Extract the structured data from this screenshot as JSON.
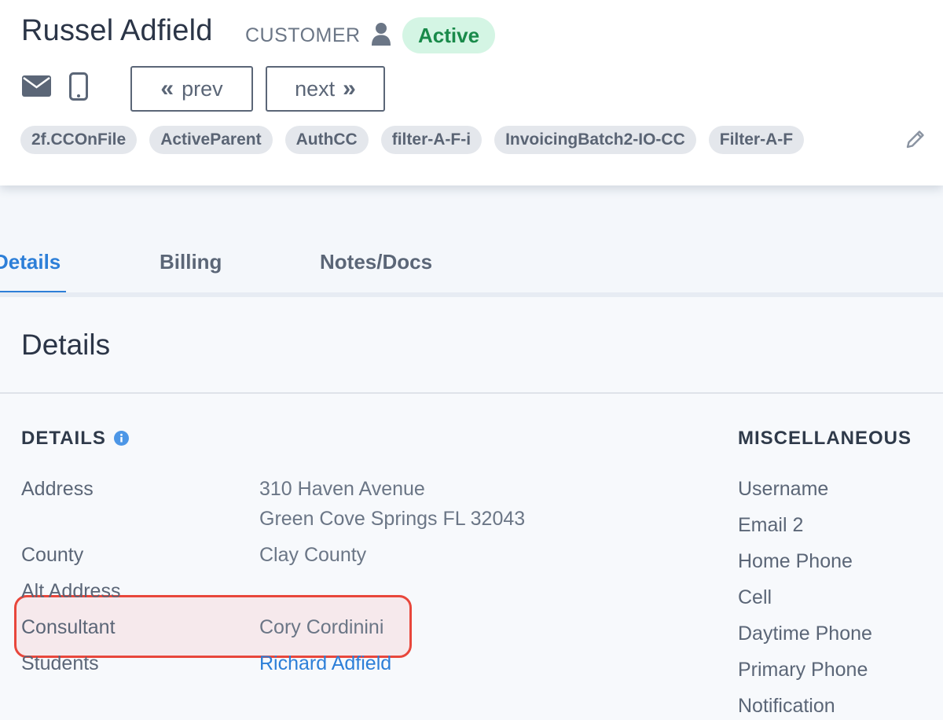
{
  "customer": {
    "name": "Russel Adfield",
    "role": "CUSTOMER",
    "status": "Active"
  },
  "icons": {
    "person": "user-icon",
    "mail": "envelope-icon",
    "phone": "mobile-phone-icon",
    "edit": "pencil-icon",
    "info": "info-circle-icon"
  },
  "nav": {
    "prev_label": "prev",
    "next_label": "next",
    "prev_chevron": "«",
    "next_chevron": "»"
  },
  "tags": [
    "2f.CCOnFile",
    "ActiveParent",
    "AuthCC",
    "filter-A-F-i",
    "InvoicingBatch2-IO-CC",
    "Filter-A-F"
  ],
  "tabs": [
    "Details",
    "Billing",
    "Notes/Docs"
  ],
  "active_tab": "Details",
  "panel": {
    "title": "Details",
    "details_heading": "DETAILS",
    "misc_heading": "MISCELLANEOUS"
  },
  "details": {
    "address_label": "Address",
    "address_line1": "310 Haven Avenue",
    "address_line2": "Green Cove Springs FL 32043",
    "county_label": "County",
    "county_value": "Clay County",
    "alt_address_label": "Alt Address",
    "consultant_label": "Consultant",
    "consultant_value": "Cory Cordinini",
    "students_label": "Students",
    "students_value": "Richard Adfield"
  },
  "misc": [
    "Username",
    "Email 2",
    "Home Phone",
    "Cell",
    "Daytime Phone",
    "Primary Phone",
    "Notification"
  ],
  "colors": {
    "accent": "#2d7fd8",
    "status_bg": "#d4f5e4",
    "status_text": "#198a4a",
    "highlight_border": "#e8473c"
  }
}
